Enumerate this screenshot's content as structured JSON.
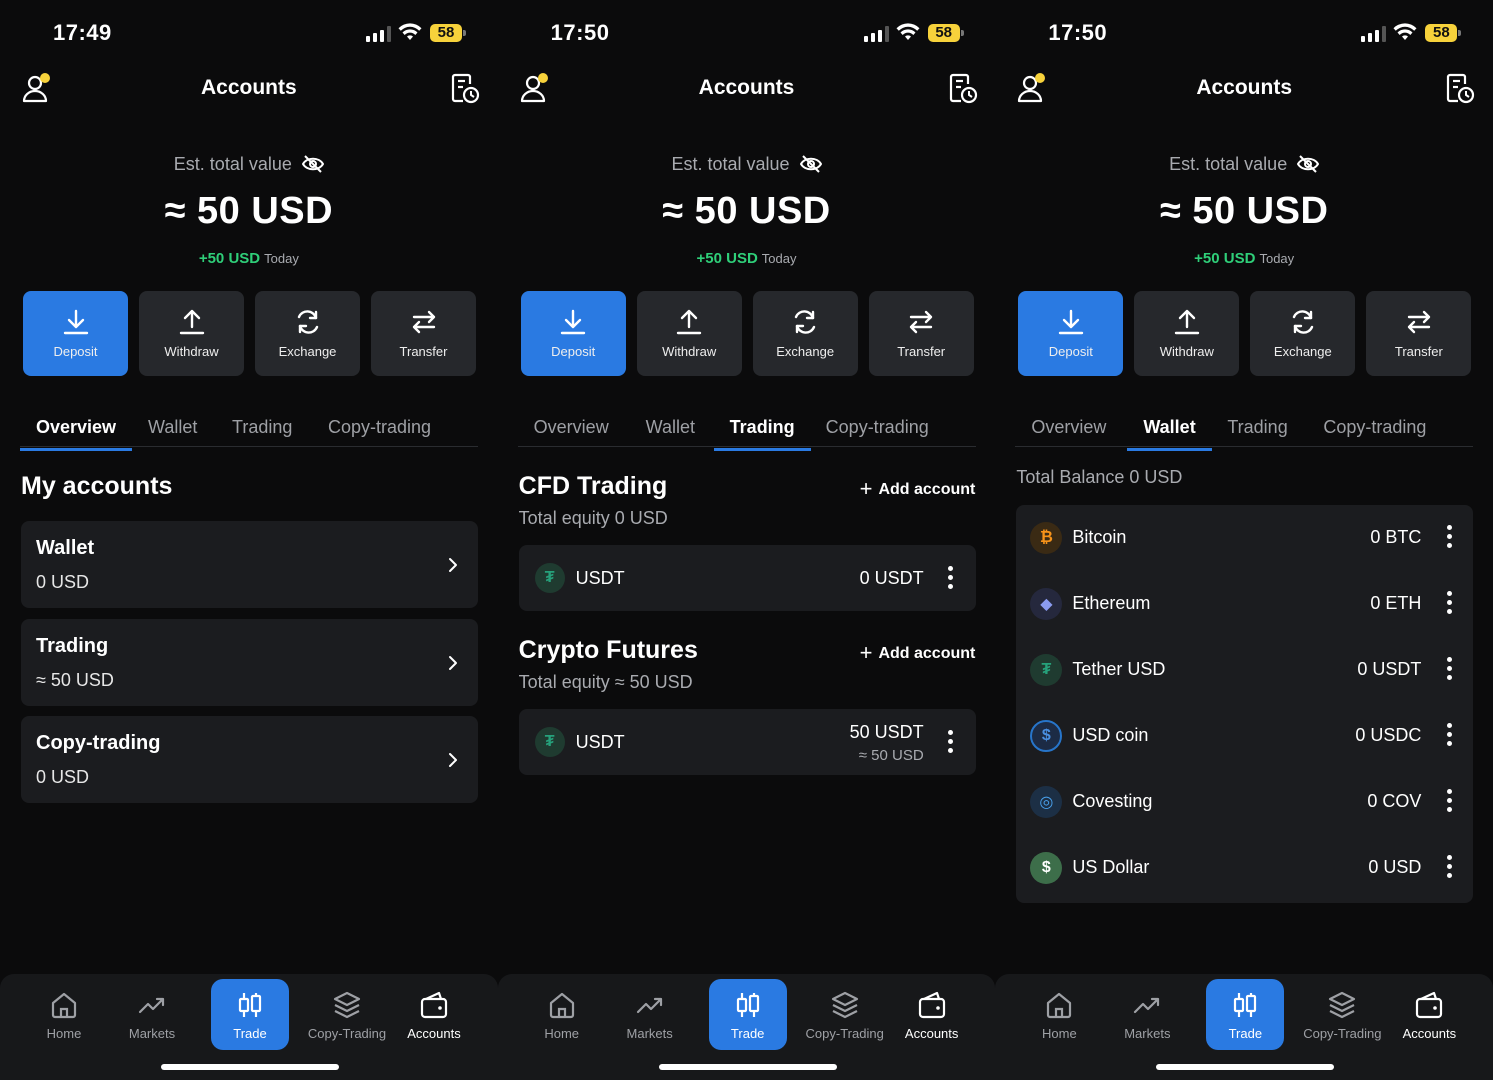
{
  "colors": {
    "accent": "#2a7ae2",
    "positive": "#2fcf79",
    "battery": "#f7d23b",
    "card": "#1b1c1f",
    "background": "#0b0b0c"
  },
  "screens": [
    {
      "time": "17:49",
      "battery": "58",
      "title": "Accounts",
      "active_tab": "overview"
    },
    {
      "time": "17:50",
      "battery": "58",
      "title": "Accounts",
      "active_tab": "trading"
    },
    {
      "time": "17:50",
      "battery": "58",
      "title": "Accounts",
      "active_tab": "wallet"
    }
  ],
  "header": {
    "title": "Accounts",
    "est_label": "Est. total value",
    "total": "≈ 50 USD",
    "delta": "+50 USD",
    "delta_period": "Today"
  },
  "actions": {
    "deposit": "Deposit",
    "withdraw": "Withdraw",
    "exchange": "Exchange",
    "transfer": "Transfer"
  },
  "tabs": {
    "overview": "Overview",
    "wallet": "Wallet",
    "trading": "Trading",
    "copy_trading": "Copy-trading"
  },
  "overview": {
    "title": "My accounts",
    "cards": [
      {
        "title": "Wallet",
        "value": "0 USD"
      },
      {
        "title": "Trading",
        "value": "≈ 50 USD"
      },
      {
        "title": "Copy-trading",
        "value": "0 USD"
      }
    ]
  },
  "trading": {
    "add_label": "Add account",
    "cfd": {
      "title": "CFD Trading",
      "equity": "Total equity 0 USD",
      "account": {
        "name": "USDT",
        "value": "0 USDT"
      }
    },
    "futures": {
      "title": "Crypto Futures",
      "equity": "Total equity ≈ 50 USD",
      "account": {
        "name": "USDT",
        "value": "50 USDT",
        "sub": "≈ 50 USD"
      }
    }
  },
  "wallet": {
    "balance": "Total Balance 0 USD",
    "assets": [
      {
        "name": "Bitcoin",
        "value": "0 BTC",
        "icon": "bitcoin-icon",
        "glyph": "₿",
        "color": "#f7931a"
      },
      {
        "name": "Ethereum",
        "value": "0 ETH",
        "icon": "ethereum-icon",
        "glyph": "◆",
        "color": "#627eea"
      },
      {
        "name": "Tether USD",
        "value": "0 USDT",
        "icon": "tether-icon",
        "glyph": "₮",
        "color": "#26a17b"
      },
      {
        "name": "USD coin",
        "value": "0 USDC",
        "icon": "usdc-icon",
        "glyph": "$",
        "color": "#2775ca"
      },
      {
        "name": "Covesting",
        "value": "0 COV",
        "icon": "covesting-icon",
        "glyph": "◎",
        "color": "#3a8ee6"
      },
      {
        "name": "US Dollar",
        "value": "0 USD",
        "icon": "dollar-icon",
        "glyph": "$",
        "color": "#4caf6a"
      }
    ]
  },
  "nav": {
    "home": "Home",
    "markets": "Markets",
    "trade": "Trade",
    "copy_trading": "Copy-Trading",
    "accounts": "Accounts"
  }
}
